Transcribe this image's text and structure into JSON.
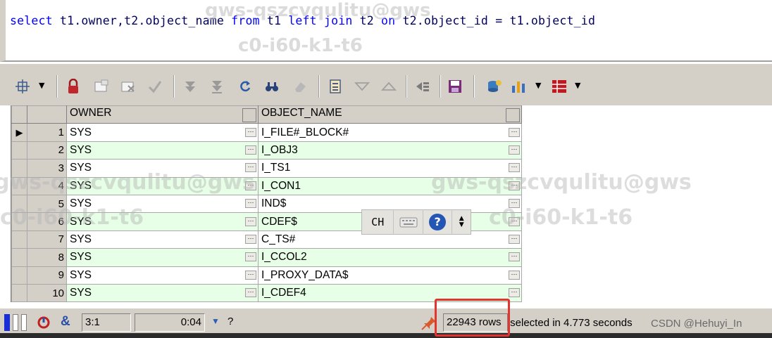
{
  "editor": {
    "sql_tokens": [
      {
        "t": "select",
        "kw": true
      },
      {
        "t": " t1.owner,t2.object_name ",
        "kw": false
      },
      {
        "t": "from",
        "kw": true
      },
      {
        "t": " t1 ",
        "kw": false
      },
      {
        "t": "left",
        "kw": true
      },
      {
        "t": " ",
        "kw": false
      },
      {
        "t": "join",
        "kw": true
      },
      {
        "t": " t2 ",
        "kw": false
      },
      {
        "t": "on",
        "kw": true
      },
      {
        "t": " t2.object_id = t1.object_id",
        "kw": false
      }
    ]
  },
  "watermarks": {
    "line1": "gws-qszcvqulitu@gws",
    "line2": "c0-i60-k1-t6"
  },
  "grid": {
    "columns": [
      "OWNER",
      "OBJECT_NAME"
    ],
    "rows": [
      {
        "num": "1",
        "owner": "SYS",
        "object_name": "I_FILE#_BLOCK#"
      },
      {
        "num": "2",
        "owner": "SYS",
        "object_name": "I_OBJ3"
      },
      {
        "num": "3",
        "owner": "SYS",
        "object_name": "I_TS1"
      },
      {
        "num": "4",
        "owner": "SYS",
        "object_name": "I_CON1"
      },
      {
        "num": "5",
        "owner": "SYS",
        "object_name": "IND$"
      },
      {
        "num": "6",
        "owner": "SYS",
        "object_name": "CDEF$"
      },
      {
        "num": "7",
        "owner": "SYS",
        "object_name": "C_TS#"
      },
      {
        "num": "8",
        "owner": "SYS",
        "object_name": "I_CCOL2"
      },
      {
        "num": "9",
        "owner": "SYS",
        "object_name": "I_PROXY_DATA$"
      },
      {
        "num": "10",
        "owner": "SYS",
        "object_name": "I_CDEF4"
      }
    ],
    "cell_button_label": "···"
  },
  "ime": {
    "mode_label": "CH",
    "help_label": "?"
  },
  "status": {
    "position": "3:1",
    "elapsed": "0:04",
    "help_label": "?",
    "rows_count": "22943 rows",
    "message": " selected in 4.773 seconds",
    "csdn": "CSDN @Hehuyi_In"
  },
  "colors": {
    "even_row": "#e6ffe6",
    "keyword": "#0000ff",
    "highlight_box": "#e3342f"
  }
}
